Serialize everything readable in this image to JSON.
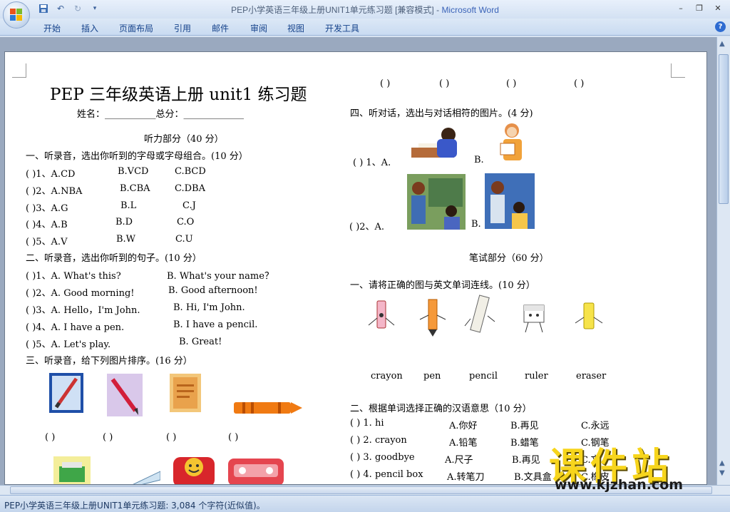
{
  "window": {
    "title_doc": "PEP小学英语三年级上册UNIT1单元练习题 [兼容模式] - ",
    "title_app": "Microsoft Word",
    "controls": [
      "–",
      "❐",
      "✕"
    ]
  },
  "ribbon_tabs": [
    "开始",
    "插入",
    "页面布局",
    "引用",
    "邮件",
    "审阅",
    "视图",
    "开发工具"
  ],
  "status": {
    "text": "PEP小学英语三年级上册UNIT1单元练习题: 3,084 个字符(近似值)。"
  },
  "doc": {
    "title": "PEP 三年级英语上册 unit1 练习题",
    "name_line": "姓名：___________总分：_____________",
    "listening_header": "听力部分（40 分）",
    "sec1": {
      "heading": "一、听录音，选出你听到的字母或字母组合。(10 分）",
      "rows": [
        {
          "num": "(      )1、A.CD",
          "b": "B.VCD",
          "c": "C.BCD"
        },
        {
          "num": "(      )2、A.NBA",
          "b": "B.CBA",
          "c": "C.DBA"
        },
        {
          "num": "(      )3、A.G",
          "b": "B.L",
          "c": "C.J"
        },
        {
          "num": "(      )4、A.B",
          "b": "B.D",
          "c": "C.O"
        },
        {
          "num": "(      )5、A.V",
          "b": "B.W",
          "c": "C.U"
        }
      ]
    },
    "sec2": {
      "heading": "二、听录音，选出你听到的句子。(10 分）",
      "rows": [
        {
          "a": "(      )1、A. What's this?",
          "b": "B. What's your name？"
        },
        {
          "a": "(      )2、A. Good morning!",
          "b": "B. Good afternoon!"
        },
        {
          "a": "(      )3、A. Hello，I'm John.",
          "b": "B. Hi, I'm John."
        },
        {
          "a": "(      )4、A. I have a pen.",
          "b": "B. I have a pencil."
        },
        {
          "a": "(      )5、A. Let's play.",
          "b": "B. Great!"
        }
      ]
    },
    "sec3": {
      "heading": "三、听录音，给下列图片排序。(16 分）",
      "parens": [
        "(      )",
        "(      )",
        "(      )",
        "(      )"
      ]
    },
    "right": {
      "top_parens": [
        "(      )",
        "(      )",
        "(      )",
        "(      )"
      ],
      "sec4_heading": "四、听对话，选出与对话相符的图片。(4 分)",
      "q1_label": "(      ) 1、A.",
      "q1_b": "B.",
      "q2_label": "(      )2、A.",
      "q2_b": "B.",
      "written_header": "笔试部分（60 分）",
      "w1_heading": "一、请将正确的图与英文单词连线。(10 分）",
      "words": [
        "crayon",
        "pen",
        "pencil",
        "ruler",
        "eraser"
      ],
      "w2_heading": "二、根据单词选择正确的汉语意思（10 分）",
      "w2_rows": [
        {
          "q": "(      ) 1. hi",
          "a": "A.你好",
          "b": "B.再见",
          "c": "C.永远"
        },
        {
          "q": "(      ) 2. crayon",
          "a": "A.铅笔",
          "b": "B.蜡笔",
          "c": "C.钢笔"
        },
        {
          "q": "(      ) 3. goodbye",
          "a": "A.尺子",
          "b": "B.再见",
          "c": "C.文"
        },
        {
          "q": "(      ) 4. pencil box",
          "a": "A.转笔刀",
          "b": "B.文具盒",
          "c": "C.橡皮"
        }
      ]
    }
  },
  "watermark": {
    "cn": "课件站",
    "url": "www.kjzhan.com"
  }
}
